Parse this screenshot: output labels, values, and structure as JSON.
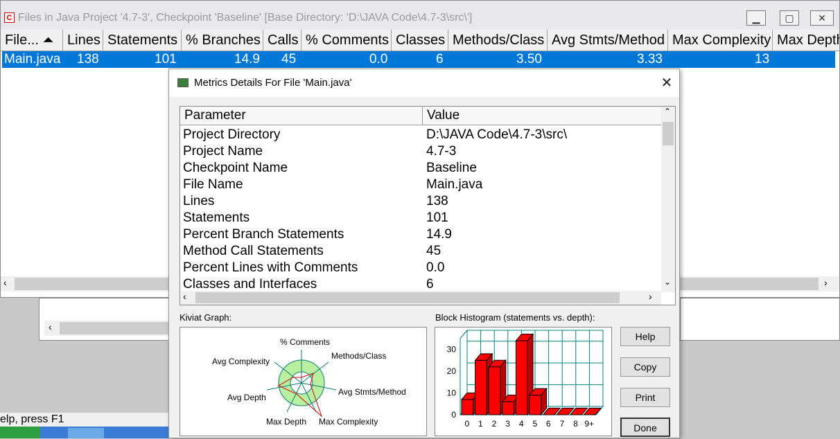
{
  "window": {
    "title": "Files in Java Project '4.7-3', Checkpoint 'Baseline'  [Base Directory: 'D:\\JAVA Code\\4.7-3\\src\\']",
    "icon_text": "C"
  },
  "columns": [
    {
      "label": "File... ⏶"
    },
    {
      "label": "Lines"
    },
    {
      "label": "Statements"
    },
    {
      "label": "% Branches"
    },
    {
      "label": "Calls"
    },
    {
      "label": "% Comments"
    },
    {
      "label": "Classes"
    },
    {
      "label": "Methods/Class"
    },
    {
      "label": "Avg Stmts/Method"
    },
    {
      "label": "Max Complexity"
    },
    {
      "label": "Max Depth"
    }
  ],
  "file_row": {
    "file": "Main.java",
    "lines": "138",
    "statements": "101",
    "branches": "14.9",
    "calls": "45",
    "comments": "0.0",
    "classes": "6",
    "methods_class": "3.50",
    "avg_stmts": "3.33",
    "max_complexity": "13"
  },
  "status": {
    "text": "elp, press F1"
  },
  "dialog": {
    "title": "Metrics Details For File 'Main.java'",
    "grid_headers": {
      "param": "Parameter",
      "value": "Value"
    },
    "rows": [
      {
        "param": "Project Directory",
        "value": "D:\\JAVA Code\\4.7-3\\src\\"
      },
      {
        "param": "Project Name",
        "value": "4.7-3"
      },
      {
        "param": "Checkpoint Name",
        "value": "Baseline"
      },
      {
        "param": "File Name",
        "value": "Main.java"
      },
      {
        "param": "Lines",
        "value": "138"
      },
      {
        "param": "Statements",
        "value": "101"
      },
      {
        "param": "Percent Branch Statements",
        "value": "14.9"
      },
      {
        "param": "Method Call Statements",
        "value": "45"
      },
      {
        "param": "Percent Lines with Comments",
        "value": "0.0"
      },
      {
        "param": "Classes and Interfaces",
        "value": "6"
      }
    ],
    "kiviat_label": "Kiviat Graph:",
    "kiviat_axes": {
      "comments": "% Comments",
      "methods": "Methods/Class",
      "avg_stmts": "Avg Stmts/Method",
      "max_complexity": "Max Complexity",
      "max_depth": "Max Depth",
      "avg_depth": "Avg Depth",
      "avg_complexity": "Avg Complexity"
    },
    "histogram_label": "Block Histogram (statements vs. depth):",
    "buttons": {
      "help": "Help",
      "copy": "Copy",
      "print": "Print",
      "done": "Done"
    }
  },
  "chart_data": {
    "type": "bar",
    "categories": [
      "0",
      "1",
      "2",
      "3",
      "4",
      "5",
      "6",
      "7",
      "8",
      "9+"
    ],
    "values": [
      7,
      25,
      22,
      6,
      34,
      9,
      0,
      0,
      0,
      0
    ],
    "ylim": [
      0,
      35
    ],
    "yticks": [
      "0",
      "10",
      "20",
      "30"
    ],
    "grid": true,
    "colors": {
      "bar": "#ff0000",
      "grid": "#008080"
    }
  }
}
